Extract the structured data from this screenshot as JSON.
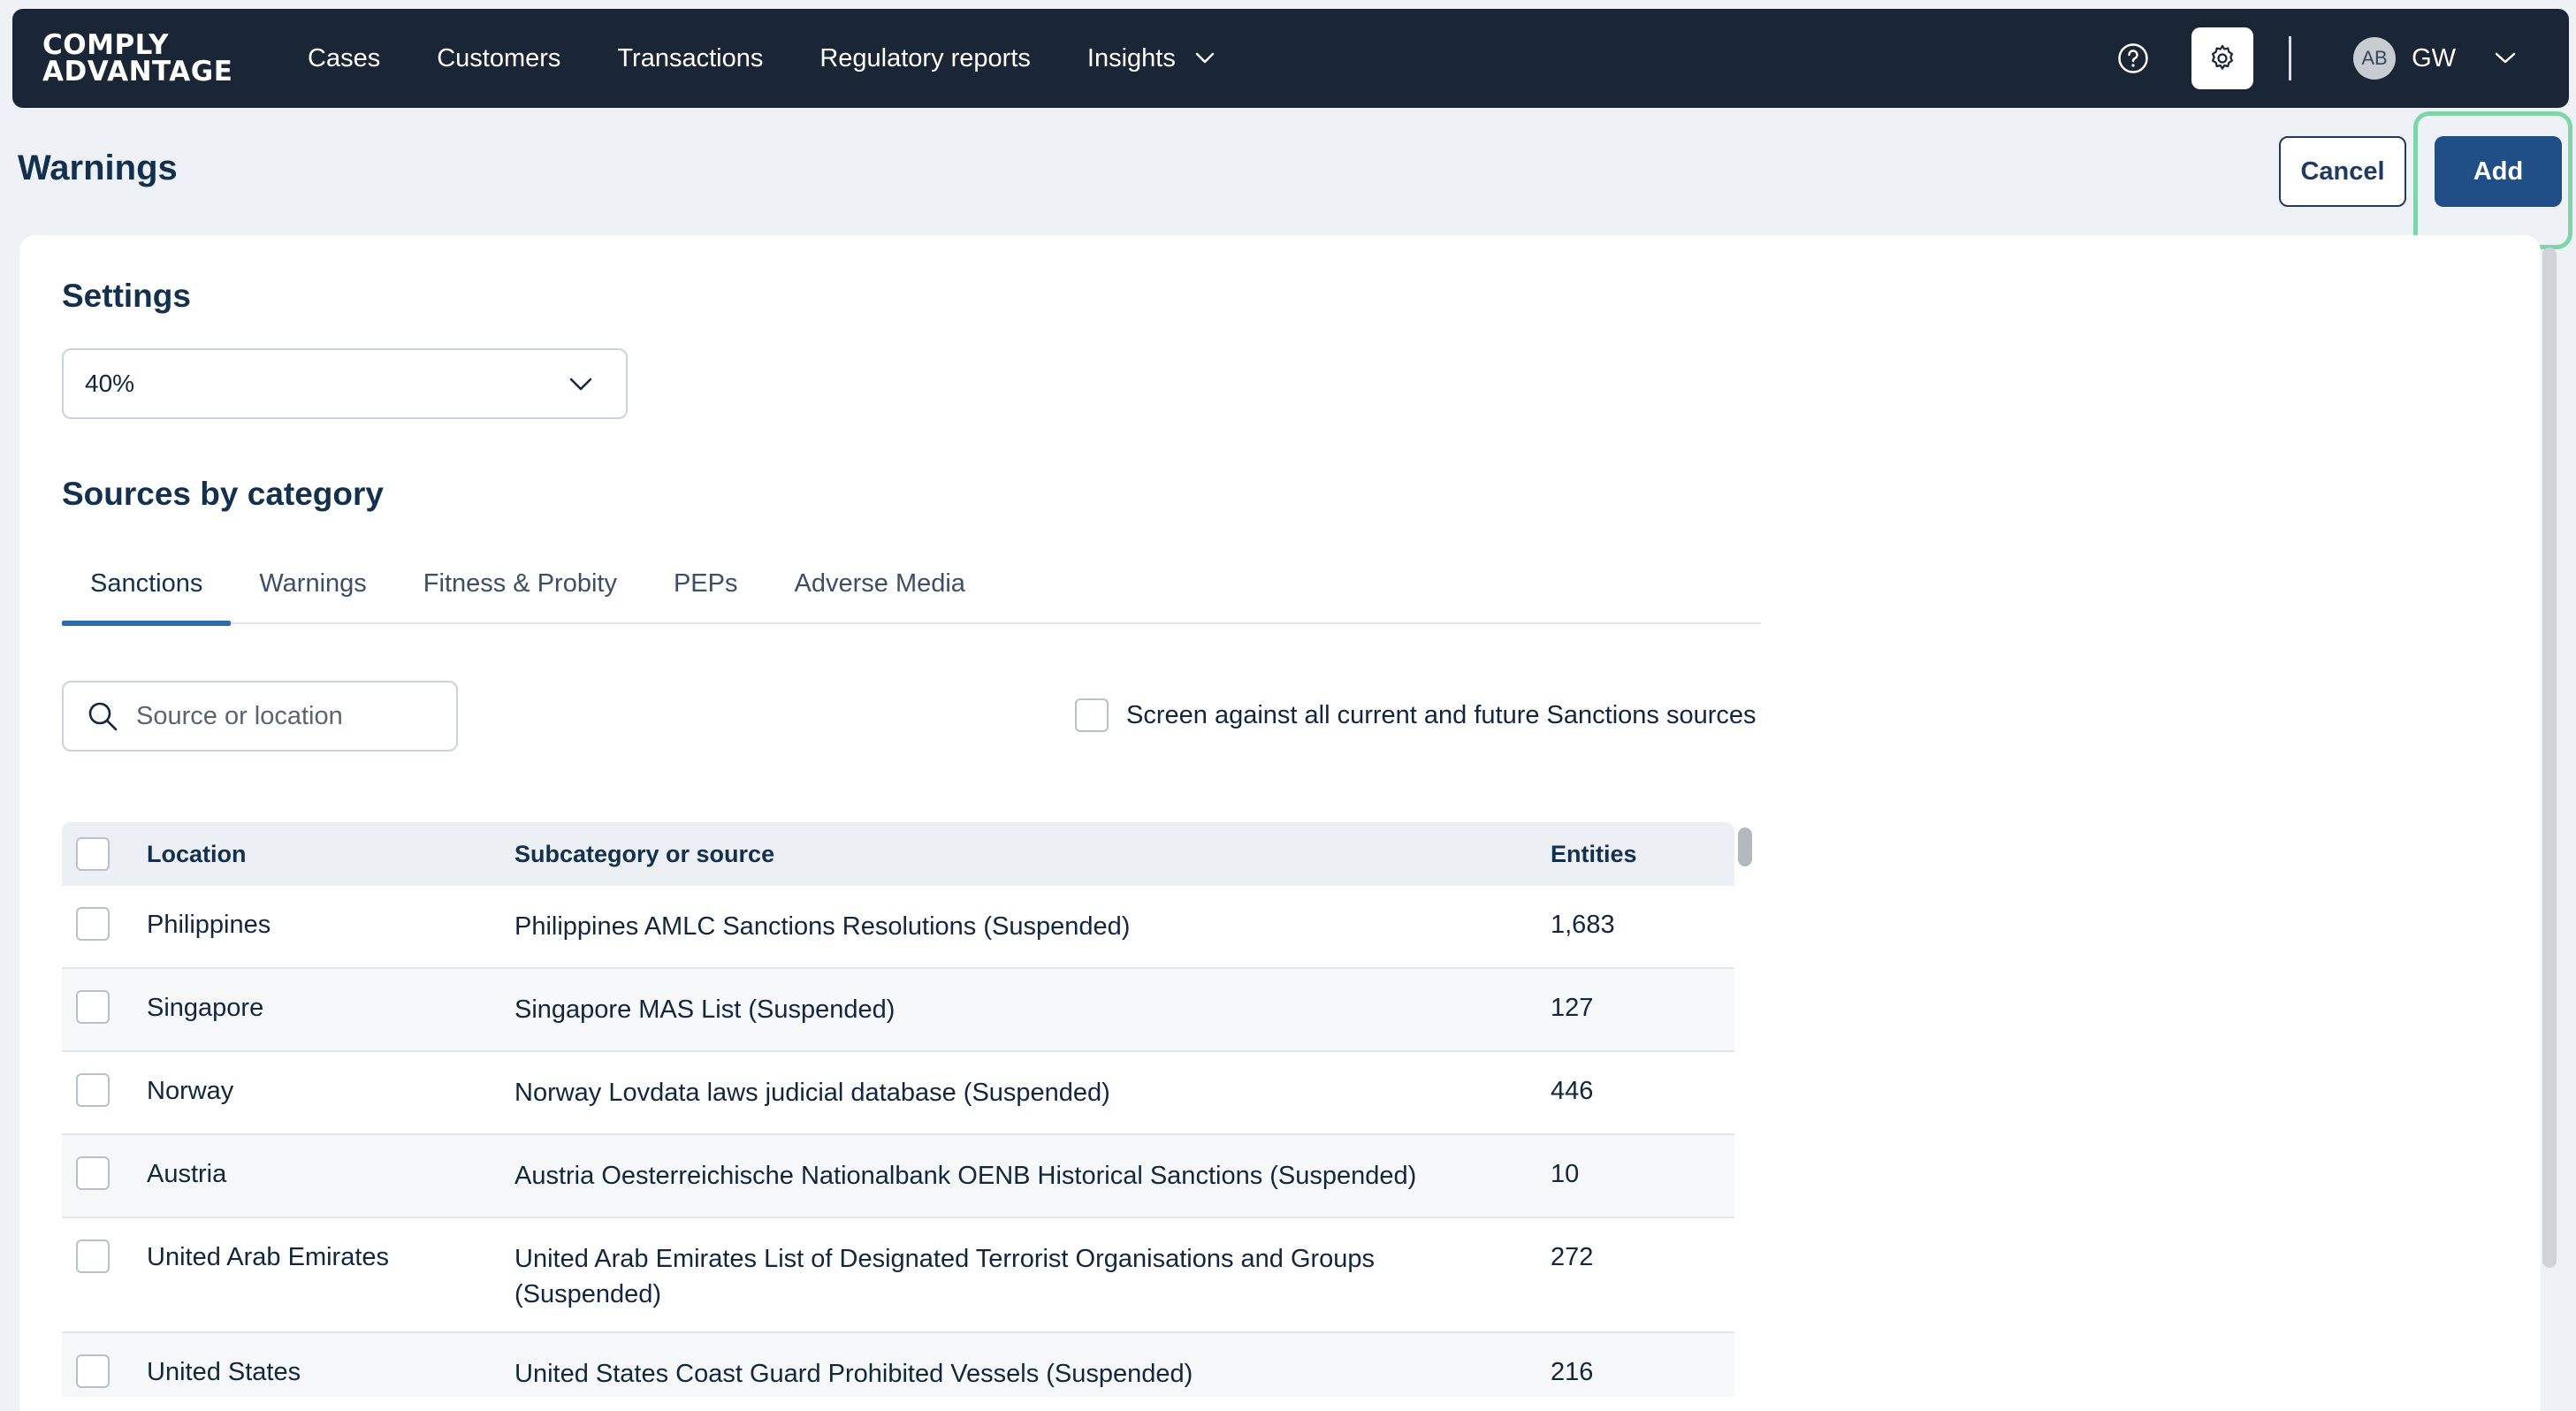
{
  "brand": {
    "line1": "COMPLY",
    "line2": "ADVANTAGE"
  },
  "nav": {
    "items": [
      {
        "label": "Cases"
      },
      {
        "label": "Customers"
      },
      {
        "label": "Transactions"
      },
      {
        "label": "Regulatory reports"
      },
      {
        "label": "Insights"
      }
    ],
    "icons": [
      "help-circle-icon",
      "gear-icon"
    ],
    "user": {
      "avatar_initials": "AB",
      "initials": "GW"
    }
  },
  "page": {
    "title": "Warnings",
    "cancel_label": "Cancel",
    "add_label": "Add"
  },
  "settings": {
    "title": "Settings",
    "threshold_value": "40%"
  },
  "sources": {
    "title": "Sources by category",
    "tabs": [
      {
        "label": "Sanctions",
        "active": true
      },
      {
        "label": "Warnings",
        "active": false
      },
      {
        "label": "Fitness & Probity",
        "active": false
      },
      {
        "label": "PEPs",
        "active": false
      },
      {
        "label": "Adverse Media",
        "active": false
      }
    ],
    "search_placeholder": "Source or location",
    "screen_all_label": "Screen against all current and future Sanctions sources",
    "table": {
      "headers": {
        "location": "Location",
        "source": "Subcategory or source",
        "entities": "Entities"
      },
      "rows": [
        {
          "location": "Philippines",
          "source": "Philippines AMLC Sanctions Resolutions (Suspended)",
          "entities": "1,683"
        },
        {
          "location": "Singapore",
          "source": "Singapore MAS List (Suspended)",
          "entities": "127"
        },
        {
          "location": "Norway",
          "source": "Norway Lovdata laws judicial database (Suspended)",
          "entities": "446"
        },
        {
          "location": "Austria",
          "source": "Austria Oesterreichische Nationalbank OENB Historical Sanctions (Suspended)",
          "entities": "10"
        },
        {
          "location": "United Arab Emirates",
          "source": "United Arab Emirates List of Designated Terrorist Organisations and Groups (Suspended)",
          "entities": "272"
        },
        {
          "location": "United States",
          "source": "United States Coast Guard Prohibited Vessels (Suspended)",
          "entities": "216"
        }
      ]
    }
  },
  "colors": {
    "nav_bg": "#1a2635",
    "primary": "#1f4f86",
    "highlight": "#7ed5a8",
    "active_tab": "#2b6cb0"
  }
}
